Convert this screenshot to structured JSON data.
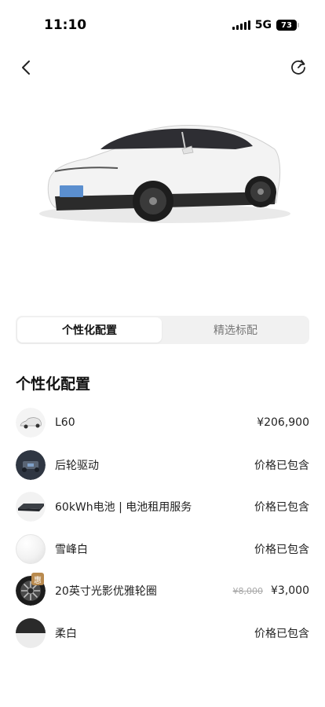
{
  "status": {
    "time": "11:10",
    "network": "5G",
    "battery": "73"
  },
  "nav": {
    "back_icon": "chevron-left-icon",
    "refresh_icon": "refresh-icon"
  },
  "tabs": [
    {
      "label": "个性化配置",
      "active": true
    },
    {
      "label": "精选标配",
      "active": false
    }
  ],
  "section": {
    "title": "个性化配置"
  },
  "config_items": [
    {
      "icon": "car-thumbnail",
      "label": "L60",
      "price": "¥206,900"
    },
    {
      "icon": "rwd-chassis-icon",
      "label": "后轮驱动",
      "price": "价格已包含"
    },
    {
      "icon": "battery-pack-icon",
      "label": "60kWh电池 | 电池租用服务",
      "price": "价格已包含"
    },
    {
      "icon": "color-swatch-white",
      "label": "雪峰白",
      "price": "价格已包含"
    },
    {
      "icon": "wheel-rim-icon",
      "label": "20英寸光影优雅轮圈",
      "old_price": "¥8,000",
      "price": "¥3,000",
      "badge": "惠"
    },
    {
      "icon": "interior-swatch",
      "label": "柔白",
      "price": "价格已包含"
    }
  ],
  "colors": {
    "accent": "#b98a4e",
    "segment_bg": "#f1f1f1",
    "car_body": "#f0f0f0"
  }
}
